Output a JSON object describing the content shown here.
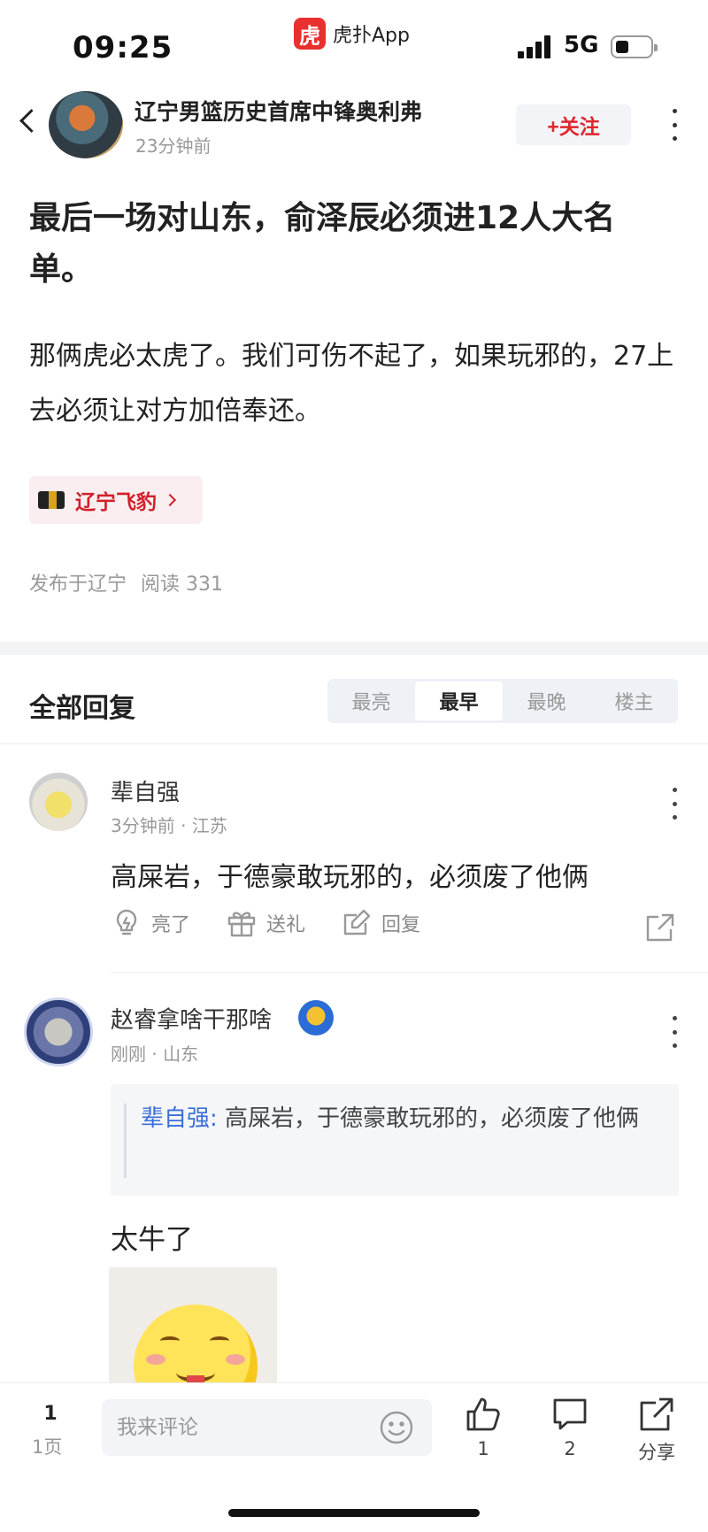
{
  "status_bar": {
    "time": "09:25",
    "app_name": "虎扑App",
    "app_logo_text": "虎",
    "network": "5G"
  },
  "header": {
    "author": "辽宁男篮历史首席中锋奥利弗",
    "time_ago": "23分钟前",
    "follow_label": "+关注"
  },
  "post": {
    "title": "最后一场对山东，俞泽辰必须进12人大名单。",
    "body": "那俩虎必太虎了。我们可伤不起了，如果玩邪的，27上去必须让对方加倍奉还。",
    "topic": "辽宁飞豹",
    "location": "发布于辽宁",
    "reads": "阅读 331"
  },
  "replies": {
    "title": "全部回复",
    "tabs": [
      {
        "label": "最亮",
        "active": false
      },
      {
        "label": "最早",
        "active": true
      },
      {
        "label": "最晚",
        "active": false
      },
      {
        "label": "楼主",
        "active": false
      }
    ]
  },
  "comments": [
    {
      "user": "辈自强",
      "meta": "3分钟前 · 江苏",
      "text": "高屎岩，于德豪敢玩邪的，必须废了他俩",
      "actions": {
        "light": "亮了",
        "gift": "送礼",
        "reply": "回复"
      }
    },
    {
      "user": "赵睿拿啥干那啥",
      "meta": "刚刚 · 山东",
      "quote_user": "辈自强:",
      "quote_text": " 高屎岩，于德豪敢玩邪的，必须废了他俩",
      "text": "太牛了"
    }
  ],
  "bottom_bar": {
    "page_current": "1",
    "page_total": "1页",
    "comment_placeholder": "我来评论",
    "likes": "1",
    "comments": "2",
    "share": "分享"
  },
  "colors": {
    "accent_red": "#e0262d",
    "quote_blue": "#3a6fd8"
  },
  "icons": [
    "back-arrow-icon",
    "more-icon",
    "lightbulb-icon",
    "gift-icon",
    "edit-reply-icon",
    "share-icon",
    "smiley-icon",
    "thumbs-up-icon",
    "comment-bubble-icon"
  ]
}
